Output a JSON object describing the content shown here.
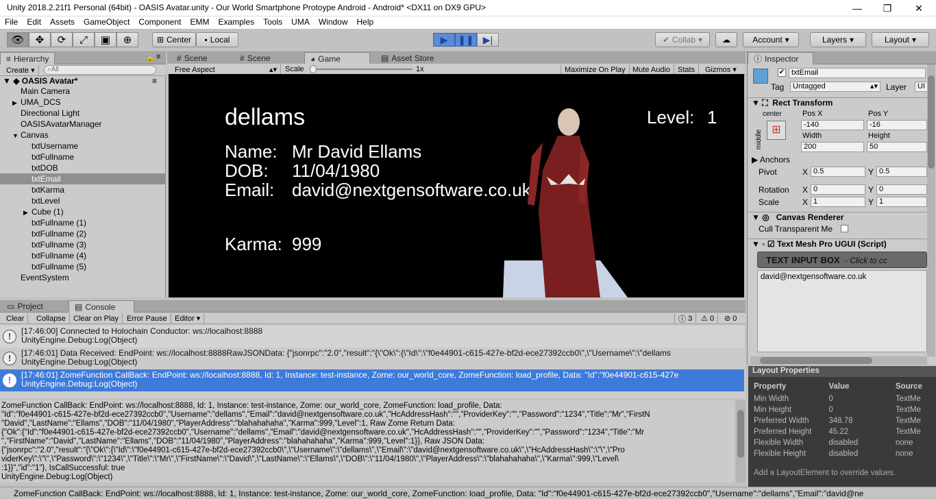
{
  "window": {
    "title": "Unity 2018.2.21f1 Personal (64bit) - OASIS Avatar.unity - Our World Smartphone Protoype Android - Android* <DX11 on DX9 GPU>"
  },
  "menu": [
    "File",
    "Edit",
    "Assets",
    "GameObject",
    "Component",
    "EMM",
    "Examples",
    "Tools",
    "UMA",
    "Window",
    "Help"
  ],
  "toolbar": {
    "center": "Center",
    "local": "Local",
    "collab": "Collab",
    "account": "Account",
    "layers": "Layers",
    "layout": "Layout"
  },
  "hierarchy": {
    "tab": "Hierarchy",
    "create": "Create",
    "search_placeholder": "All",
    "scene": "OASIS Avatar*",
    "items": [
      {
        "label": "Main Camera",
        "depth": 1,
        "arrow": ""
      },
      {
        "label": "UMA_DCS",
        "depth": 1,
        "arrow": "▶"
      },
      {
        "label": "Directional Light",
        "depth": 1,
        "arrow": ""
      },
      {
        "label": "OASISAvatarManager",
        "depth": 1,
        "arrow": ""
      },
      {
        "label": "Canvas",
        "depth": 1,
        "arrow": "▼"
      },
      {
        "label": "txtUsername",
        "depth": 2,
        "arrow": ""
      },
      {
        "label": "txtFullname",
        "depth": 2,
        "arrow": ""
      },
      {
        "label": "txtDOB",
        "depth": 2,
        "arrow": ""
      },
      {
        "label": "txtEmail",
        "depth": 2,
        "arrow": "",
        "selected": true
      },
      {
        "label": "txtKarma",
        "depth": 2,
        "arrow": ""
      },
      {
        "label": "txtLevel",
        "depth": 2,
        "arrow": ""
      },
      {
        "label": "Cube (1)",
        "depth": 2,
        "arrow": "▶"
      },
      {
        "label": "txtFullname (1)",
        "depth": 2,
        "arrow": ""
      },
      {
        "label": "txtFullname (2)",
        "depth": 2,
        "arrow": ""
      },
      {
        "label": "txtFullname (3)",
        "depth": 2,
        "arrow": ""
      },
      {
        "label": "txtFullname (4)",
        "depth": 2,
        "arrow": ""
      },
      {
        "label": "txtFullname (5)",
        "depth": 2,
        "arrow": ""
      },
      {
        "label": "EventSystem",
        "depth": 1,
        "arrow": ""
      }
    ]
  },
  "center_tabs": [
    "Scene",
    "Scene",
    "Game",
    "Asset Store"
  ],
  "game_bar": {
    "aspect": "Free Aspect",
    "scale_label": "Scale",
    "scale_value": "1x",
    "maximize": "Maximize On Play",
    "mute": "Mute Audio",
    "stats": "Stats",
    "gizmos": "Gizmos"
  },
  "game": {
    "username": "dellams",
    "level_label": "Level:",
    "level_value": "1",
    "name_label": "Name:",
    "name_value": "Mr David Ellams",
    "dob_label": "DOB:",
    "dob_value": "11/04/1980",
    "email_label": "Email:",
    "email_value": "david@nextgensoftware.co.uk",
    "karma_label": "Karma:",
    "karma_value": "999"
  },
  "console": {
    "tab_project": "Project",
    "tab_console": "Console",
    "btn_clear": "Clear",
    "btn_collapse": "Collapse",
    "btn_clear_play": "Clear on Play",
    "btn_error_pause": "Error Pause",
    "btn_editor": "Editor",
    "count_log": "3",
    "count_warn": "0",
    "count_err": "0",
    "rows": [
      {
        "l1": "[17:46:00] Connected to Holochain Conductor: ws://localhost:8888",
        "l2": "UnityEngine.Debug:Log(Object)"
      },
      {
        "l1": "[17:46:01] Data Received: EndPoint: ws://localhost:8888RawJSONData: {\"jsonrpc\":\"2.0\",\"result\":\"{\\\"Ok\\\":{\\\"Id\\\":\\\"f0e44901-c615-427e-bf2d-ece27392ccb0\\\",\\\"Username\\\":\\\"dellams",
        "l2": "UnityEngine.Debug:Log(Object)"
      },
      {
        "l1": "[17:46:01] ZomeFunction CallBack: EndPoint: ws://localhost:8888, Id: 1, Instance: test-instance, Zome: our_world_core, ZomeFunction: load_profile, Data: \"Id\":\"f0e44901-c615-427e",
        "l2": "UnityEngine.Debug:Log(Object)"
      }
    ],
    "detail": "ZomeFunction CallBack: EndPoint: ws://localhost:8888, Id: 1, Instance: test-instance, Zome: our_world_core, ZomeFunction: load_profile, Data:\n\"Id\":\"f0e44901-c615-427e-bf2d-ece27392ccb0\",\"Username\":\"dellams\",\"Email\":\"david@nextgensoftware.co.uk\",\"HcAddressHash\":\"\",\"ProviderKey\":\"\",\"Password\":\"1234\",\"Title\":\"Mr\",\"FirstN\n\"David\",\"LastName\":\"Ellams\",\"DOB\":\"11/04/1980\",\"PlayerAddress\":\"blahahahaha\",\"Karma\":999,\"Level\":1, Raw Zome Return Data:\n{\"Ok\":{\"Id\":\"f0e44901-c615-427e-bf2d-ece27392ccb0\",\"Username\":\"dellams\",\"Email\":\"david@nextgensoftware.co.uk\",\"HcAddressHash\":\"\",\"ProviderKey\":\"\",\"Password\":\"1234\",\"Title\":\"Mr\n\",\"FirstName\":\"David\",\"LastName\":\"Ellams\",\"DOB\":\"11/04/1980\",\"PlayerAddress\":\"blahahahaha\",\"Karma\":999,\"Level\":1}}, Raw JSON Data:\n{\"jsonrpc\":\"2.0\",\"result\":\"{\\\"Ok\\\":{\\\"Id\\\":\\\"f0e44901-c615-427e-bf2d-ece27392ccb0\\\",\\\"Username\\\":\\\"dellams\\\",\\\"Email\\\":\\\"david@nextgensoftware.co.uk\\\",\\\"HcAddressHash\\\":\\\"\\\",\\\"Pro\nviderKey\\\":\\\"\\\",\\\"Password\\\":\\\"1234\\\",\\\"Title\\\":\\\"Mr\\\",\\\"FirstName\\\":\\\"David\\\",\\\"LastName\\\":\\\"Ellams\\\",\\\"DOB\\\":\\\"11/04/1980\\\",\\\"PlayerAddress\\\":\\\"blahahahaha\\\",\\\"Karma\\\":999,\\\"Level\\\n:1}}\",\"id\":\"1\"}, IsCallSuccessful: true\nUnityEngine.Debug:Log(Object)"
  },
  "status": "ZomeFunction CallBack: EndPoint: ws://localhost:8888, Id: 1, Instance: test-instance, Zome: our_world_core, ZomeFunction: load_profile, Data: \"Id\":\"f0e44901-c615-427e-bf2d-ece27392ccb0\",\"Username\":\"dellams\",\"Email\":\"david@ne",
  "inspector": {
    "tab": "Inspector",
    "name": "txtEmail",
    "tag_label": "Tag",
    "tag": "Untagged",
    "layer_label": "Layer",
    "layer": "UI",
    "rect_title": "Rect Transform",
    "anchor_h": "center",
    "anchor_v": "middle",
    "posx_label": "Pos X",
    "posy_label": "Pos Y",
    "posx": "-140",
    "posy": "-16",
    "width_label": "Width",
    "height_label": "Height",
    "width": "200",
    "height": "50",
    "anchors": "Anchors",
    "pivot": "Pivot",
    "pivot_x": "0.5",
    "pivot_y": "0.5",
    "rotation": "Rotation",
    "rot_x": "0",
    "rot_y": "0",
    "scale": "Scale",
    "scale_x": "1",
    "scale_y": "1",
    "x": "X",
    "y": "Y",
    "canvas_renderer": "Canvas Renderer",
    "cull": "Cull Transparent Me",
    "tmp_title": "Text Mesh Pro UGUI (Script)",
    "input_box": "TEXT INPUT BOX",
    "click_hint": "- Click to cc",
    "input_text": "david@nextgensoftware.co.uk"
  },
  "layout_props": {
    "title": "Layout Properties",
    "headers": [
      "Property",
      "Value",
      "Source"
    ],
    "rows": [
      [
        "Min Width",
        "0",
        "TextMe"
      ],
      [
        "Min Height",
        "0",
        "TextMe"
      ],
      [
        "Preferred Width",
        "348.78",
        "TextMe"
      ],
      [
        "Preferred Height",
        "45.22",
        "TextMe"
      ],
      [
        "Flexible Width",
        "disabled",
        "none"
      ],
      [
        "Flexible Height",
        "disabled",
        "none"
      ]
    ],
    "hint": "Add a LayoutElement to override values."
  }
}
